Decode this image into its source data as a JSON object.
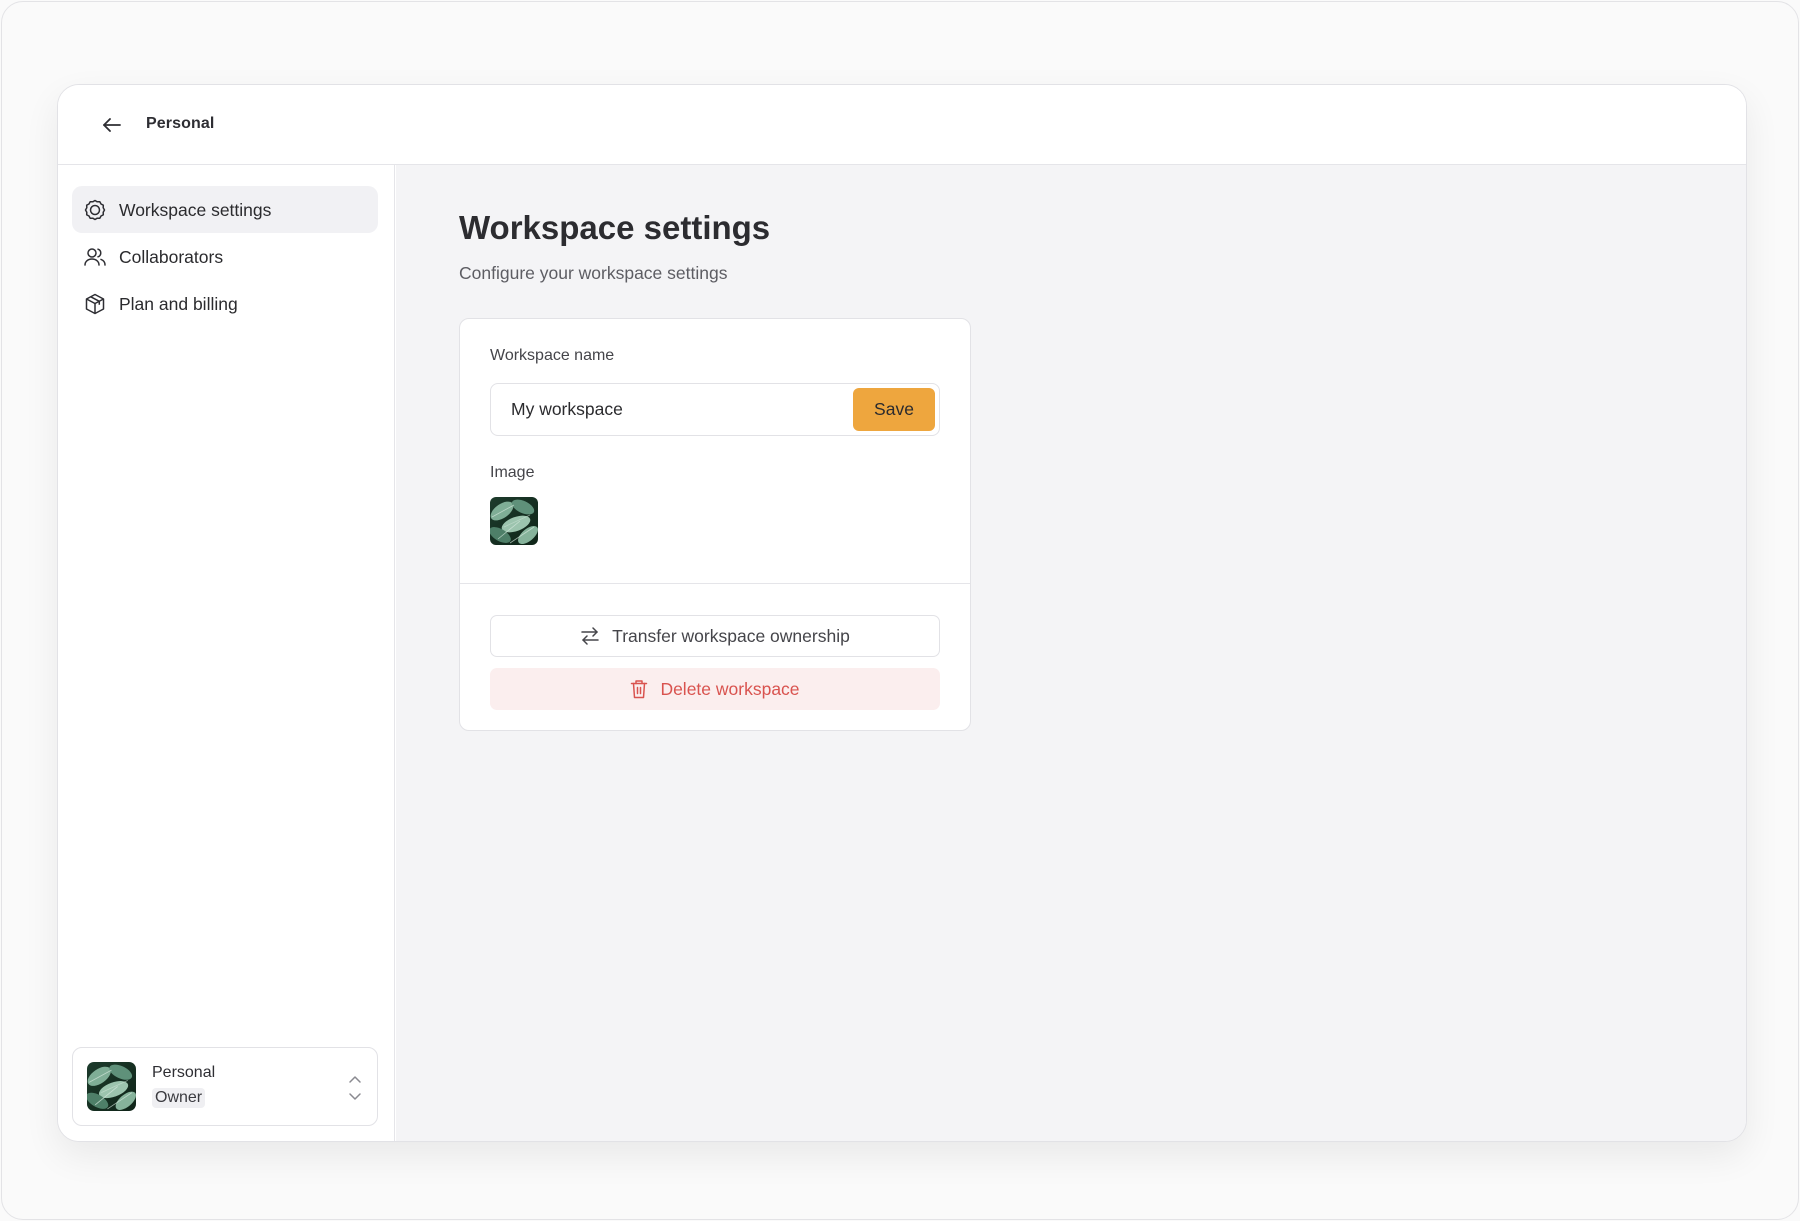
{
  "topbar": {
    "back_icon": "arrow-left-icon",
    "title": "Personal"
  },
  "sidebar": {
    "items": [
      {
        "label": "Workspace settings",
        "icon": "gear-icon",
        "active": true
      },
      {
        "label": "Collaborators",
        "icon": "users-icon",
        "active": false
      },
      {
        "label": "Plan and billing",
        "icon": "package-icon",
        "active": false
      }
    ],
    "workspace_switcher": {
      "name": "Personal",
      "role": "Owner",
      "icon": "chevrons-up-down-icon"
    }
  },
  "main": {
    "title": "Workspace settings",
    "subtitle": "Configure your workspace settings",
    "card": {
      "name_label": "Workspace name",
      "name_value": "My workspace",
      "save_label": "Save",
      "image_label": "Image",
      "transfer_label": "Transfer workspace ownership",
      "delete_label": "Delete workspace"
    }
  },
  "colors": {
    "accent": "#eea63e",
    "danger": "#d9534f",
    "danger_bg": "#fbeeee",
    "active_nav_bg": "#f1f1f4",
    "content_bg": "#f4f4f6"
  }
}
